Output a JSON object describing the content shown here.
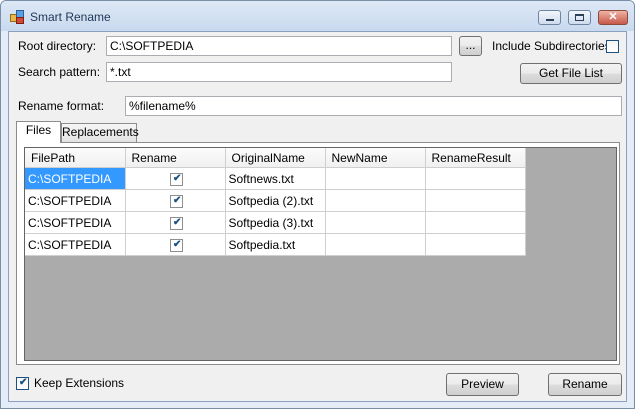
{
  "window": {
    "title": "Smart Rename",
    "icon": "app-icon"
  },
  "form": {
    "root_directory_label": "Root directory:",
    "root_directory_value": "C:\\SOFTPEDIA",
    "browse_label": "...",
    "include_subdirs_label": "Include Subdirectories",
    "include_subdirs_checked": false,
    "search_pattern_label": "Search pattern:",
    "search_pattern_value": "*.txt",
    "get_file_list_label": "Get File List",
    "rename_format_label": "Rename format:",
    "rename_format_value": "%filename%"
  },
  "tabs": [
    {
      "label": "Files",
      "active": true
    },
    {
      "label": "Replacements",
      "active": false
    }
  ],
  "grid": {
    "columns": [
      "FilePath",
      "Rename",
      "OriginalName",
      "NewName",
      "RenameResult"
    ],
    "rows": [
      {
        "filepath": "C:\\SOFTPEDIA",
        "rename": true,
        "original": "Softnews.txt",
        "new": "",
        "result": ""
      },
      {
        "filepath": "C:\\SOFTPEDIA",
        "rename": true,
        "original": "Softpedia (2).txt",
        "new": "",
        "result": ""
      },
      {
        "filepath": "C:\\SOFTPEDIA",
        "rename": true,
        "original": "Softpedia (3).txt",
        "new": "",
        "result": ""
      },
      {
        "filepath": "C:\\SOFTPEDIA",
        "rename": true,
        "original": "Softpedia.txt",
        "new": "",
        "result": ""
      }
    ]
  },
  "footer": {
    "keep_extensions_label": "Keep Extensions",
    "keep_extensions_checked": true,
    "preview_label": "Preview",
    "rename_label": "Rename"
  },
  "colors": {
    "selection": "#3399ff",
    "titlebar": "#c9d9ee"
  }
}
